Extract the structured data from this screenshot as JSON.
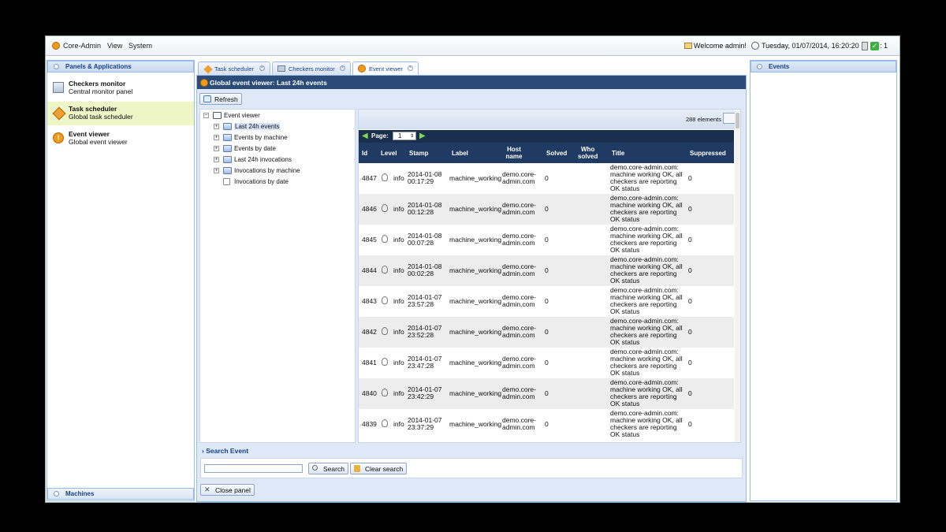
{
  "menubar": {
    "app_title": "Core-Admin",
    "menu_view": "View",
    "menu_system": "System",
    "welcome": "Welcome admin!",
    "datetime": "Tuesday, 01/07/2014, 16:20:20",
    "status_count": ": 1"
  },
  "left_panel": {
    "title": "Panels & Applications",
    "footer": "Machines",
    "items": [
      {
        "name": "Checkers monitor",
        "desc": "Central monitor panel"
      },
      {
        "name": "Task scheduler",
        "desc": "Global task scheduler"
      },
      {
        "name": "Event viewer",
        "desc": "Global event viewer"
      }
    ]
  },
  "tabs": [
    "Task scheduler",
    "Checkers monitor",
    "Event viewer"
  ],
  "center": {
    "title": "Global event viewer: Last 24h events",
    "refresh": "Refresh",
    "tree": {
      "root": "Event viewer",
      "nodes": [
        "Last 24h events",
        "Events by machine",
        "Events by date",
        "Last 24h invocations",
        "Invocations by machine",
        "Invocations by date"
      ]
    },
    "grid": {
      "count": "288 elements",
      "page_label": "Page:",
      "page_value": "1",
      "columns": {
        "id": "Id",
        "level": "Level",
        "stamp": "Stamp",
        "label": "Label",
        "host_1": "Host",
        "host_2": "name",
        "solved": "Solved",
        "who_1": "Who",
        "who_2": "solved",
        "title": "Title",
        "suppressed": "Suppressed"
      },
      "rows": [
        {
          "id": "4847",
          "level": "info",
          "date": "2014-01-08",
          "time": "00:17:29",
          "label": "machine_working",
          "host_1": "demo.core-",
          "host_2": "admin.com",
          "solved": "0",
          "suppressed": "0"
        },
        {
          "id": "4846",
          "level": "info",
          "date": "2014-01-08",
          "time": "00:12:28",
          "label": "machine_working",
          "host_1": "demo.core-",
          "host_2": "admin.com",
          "solved": "0",
          "suppressed": "0"
        },
        {
          "id": "4845",
          "level": "info",
          "date": "2014-01-08",
          "time": "00:07:28",
          "label": "machine_working",
          "host_1": "demo.core-",
          "host_2": "admin.com",
          "solved": "0",
          "suppressed": "0"
        },
        {
          "id": "4844",
          "level": "info",
          "date": "2014-01-08",
          "time": "00:02:28",
          "label": "machine_working",
          "host_1": "demo.core-",
          "host_2": "admin.com",
          "solved": "0",
          "suppressed": "0"
        },
        {
          "id": "4843",
          "level": "info",
          "date": "2014-01-07",
          "time": "23:57:28",
          "label": "machine_working",
          "host_1": "demo.core-",
          "host_2": "admin.com",
          "solved": "0",
          "suppressed": "0"
        },
        {
          "id": "4842",
          "level": "info",
          "date": "2014-01-07",
          "time": "23:52:28",
          "label": "machine_working",
          "host_1": "demo.core-",
          "host_2": "admin.com",
          "solved": "0",
          "suppressed": "0"
        },
        {
          "id": "4841",
          "level": "info",
          "date": "2014-01-07",
          "time": "23:47:28",
          "label": "machine_working",
          "host_1": "demo.core-",
          "host_2": "admin.com",
          "solved": "0",
          "suppressed": "0"
        },
        {
          "id": "4840",
          "level": "info",
          "date": "2014-01-07",
          "time": "23:42:29",
          "label": "machine_working",
          "host_1": "demo.core-",
          "host_2": "admin.com",
          "solved": "0",
          "suppressed": "0"
        },
        {
          "id": "4839",
          "level": "info",
          "date": "2014-01-07",
          "time": "23:37:29",
          "label": "machine_working",
          "host_1": "demo.core-",
          "host_2": "admin.com",
          "solved": "0",
          "suppressed": "0"
        }
      ],
      "title_lines": [
        "demo.core-admin.com:",
        "machine working OK, all",
        "checkers are reporting",
        "OK status"
      ]
    },
    "search_title": "Search Event",
    "search_button": "Search",
    "clear_button": "Clear search",
    "close_button": "Close panel"
  },
  "right_panel": {
    "title": "Events"
  },
  "colors": {
    "accent": "#15428b",
    "header_dark": "#1f3a63",
    "panel_bg": "#dfe8f6",
    "selected": "#eef6c8"
  }
}
